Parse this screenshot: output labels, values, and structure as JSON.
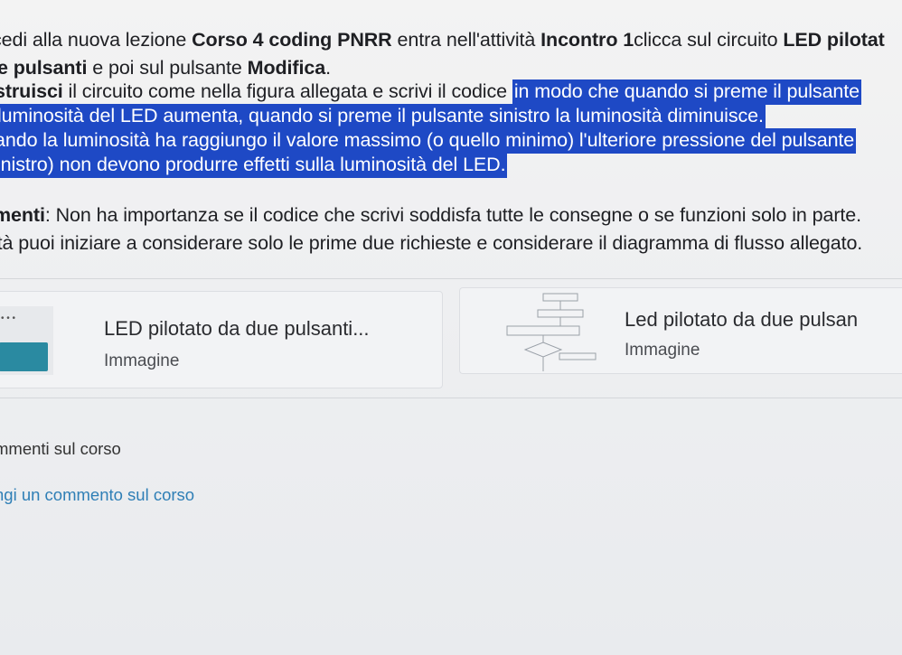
{
  "instructions": {
    "l1": {
      "a": "cedi alla nuova lezione ",
      "b": "Corso 4 coding PNRR",
      "c": " entra nell'attività ",
      "d": "Incontro 1",
      "e": "clicca sul circuito ",
      "f": "LED pilotat"
    },
    "l2": {
      "a": "e pulsanti",
      "b": " e poi sul pulsante ",
      "c": "Modifica",
      "d": "."
    },
    "l3": {
      "a": "struisci",
      "b": " il circuito come nella figura allegata e scrivi il codice ",
      "c": "in modo che quando si preme il pulsante"
    },
    "l4": "luminosità del LED aumenta, quando si preme il pulsante sinistro la luminosità diminuisce.",
    "l5": "ando la luminosità ha raggiungo il valore massimo (o quello minimo) l'ulteriore pressione del pulsante",
    "l6": "inistro) non devono produrre effetti sulla luminosità del LED.",
    "l7": {
      "a": "menti",
      "b": ": Non ha importanza se il codice che scrivi soddisfa tutte le consegne o se funzioni solo in parte."
    },
    "l8": "ità puoi iniziare a considerare solo le prime due richieste e considerare il diagramma di flusso allegato."
  },
  "attachments": [
    {
      "title": "LED pilotato da due pulsanti...",
      "type": "Immagine",
      "icon": "circuit-board-thumbnail"
    },
    {
      "title": "Led pilotato da due pulsan",
      "type": "Immagine",
      "icon": "flowchart-thumbnail"
    }
  ],
  "comments": {
    "title": "mmenti sul corso",
    "add_link": "ngi un commento sul corso"
  },
  "colors": {
    "highlight": "#1e49c5",
    "link": "#2f7fb6"
  }
}
